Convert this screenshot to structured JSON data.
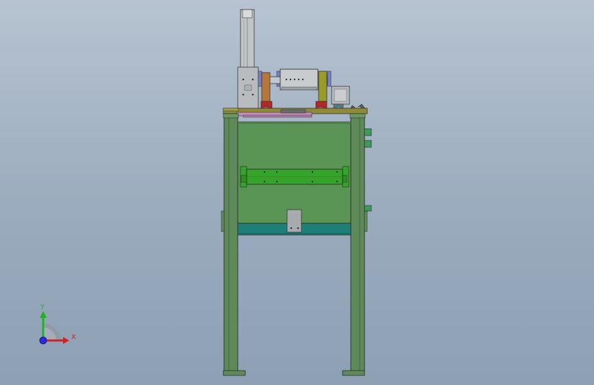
{
  "triad": {
    "y_label": "Y",
    "x_label": "X",
    "y_color": "#1fb31f",
    "x_color": "#d42020",
    "z_color": "#2a2ae0"
  },
  "colors": {
    "background": "#a3b2c3",
    "frame_green": "#5e8a5a",
    "panel_green": "#5a9556",
    "rail_green": "#36a42a",
    "teal_band": "#1e7f78",
    "linear_module_grey": "#b7bbbf",
    "copper_plate": "#b5773a",
    "olive_plate": "#9a9a2a",
    "red_part": "#b02828",
    "pink_plate": "#c98fc0",
    "purple_block": "#7b7fc9"
  }
}
